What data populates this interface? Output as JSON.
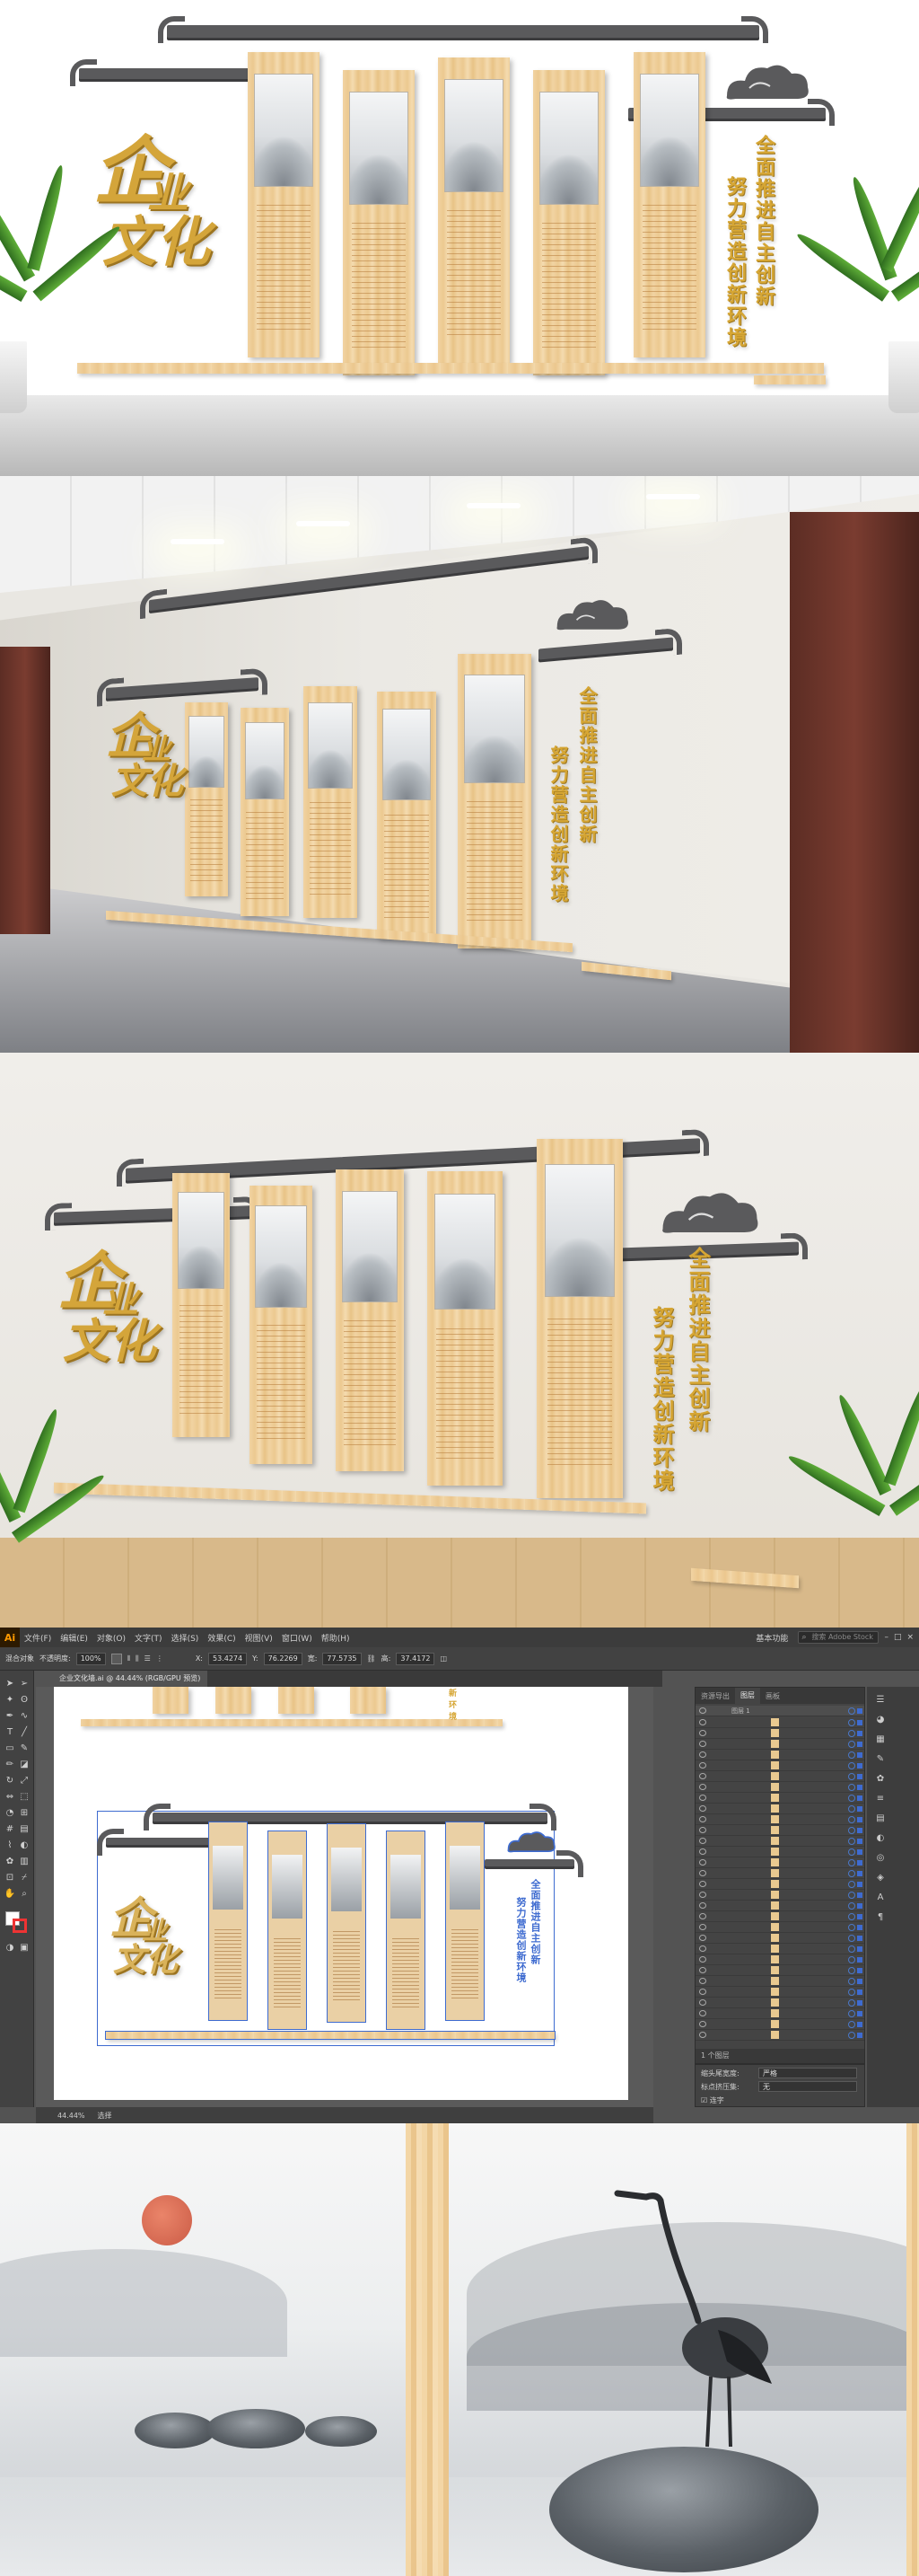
{
  "wall": {
    "calligraphy_line1": "企",
    "calligraphy_line2": "业",
    "calligraphy_line3": "文化",
    "slogan_line1": "全面推进自主创新",
    "slogan_line2": "努力营造创新环境"
  },
  "illustrator": {
    "logo": "Ai",
    "menus": [
      "文件(F)",
      "编辑(E)",
      "对象(O)",
      "文字(T)",
      "选择(S)",
      "效果(C)",
      "视图(V)",
      "窗口(W)",
      "帮助(H)"
    ],
    "workspace": "基本功能",
    "search_placeholder": "搜索 Adobe Stock",
    "control": {
      "no_selection": "混合对象",
      "opacity_label": "不透明度:",
      "opacity_value": "100%",
      "x_label": "X:",
      "x_value": "53.4274",
      "y_label": "Y:",
      "y_value": "76.2269",
      "w_label": "宽:",
      "w_value": "77.5735",
      "h_label": "高:",
      "h_value": "37.4172"
    },
    "document_tab": "企业文化墙.ai @ 44.44% (RGB/GPU 预览)",
    "status": {
      "zoom": "44.44%",
      "tool": "选择"
    },
    "panel_tabs": [
      "资源导出",
      "图层",
      "画板"
    ],
    "layer_name": "图层 1",
    "layer_count": "1 个图层",
    "properties": {
      "align_label": "缩头尾宽度:",
      "align_value": "严格",
      "punct_label": "标点挤压集:",
      "punct_value": "无",
      "checkbox_label": "连字"
    }
  }
}
